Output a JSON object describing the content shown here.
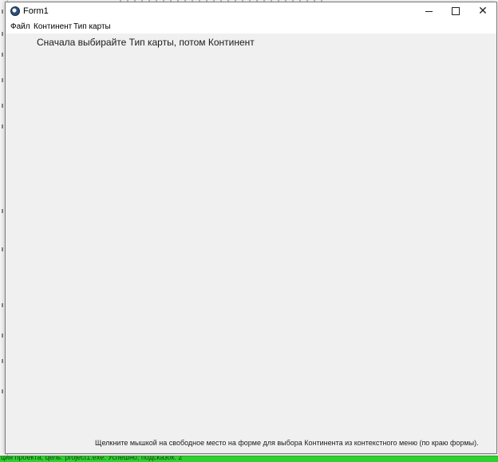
{
  "window": {
    "title": "Form1",
    "minimize_icon": "minimize-icon",
    "maximize_icon": "maximize-icon",
    "close_icon": "close-icon",
    "close_glyph": "✕"
  },
  "menu": {
    "items": [
      {
        "label": "Файл"
      },
      {
        "label": "Континент"
      },
      {
        "label": "Тип карты"
      }
    ]
  },
  "content": {
    "top_hint": "Сначала выбирайте Тип карты, потом Континент",
    "bottom_hint": "Щелкните мышкой на свободное место на форме для выбора Континента из контекстного меню (по краю формы)."
  },
  "background": {
    "status_text": "ция проекта, цель: project1.exe: Успешно, подсказок: 2",
    "status_color": "#2fd12f"
  }
}
